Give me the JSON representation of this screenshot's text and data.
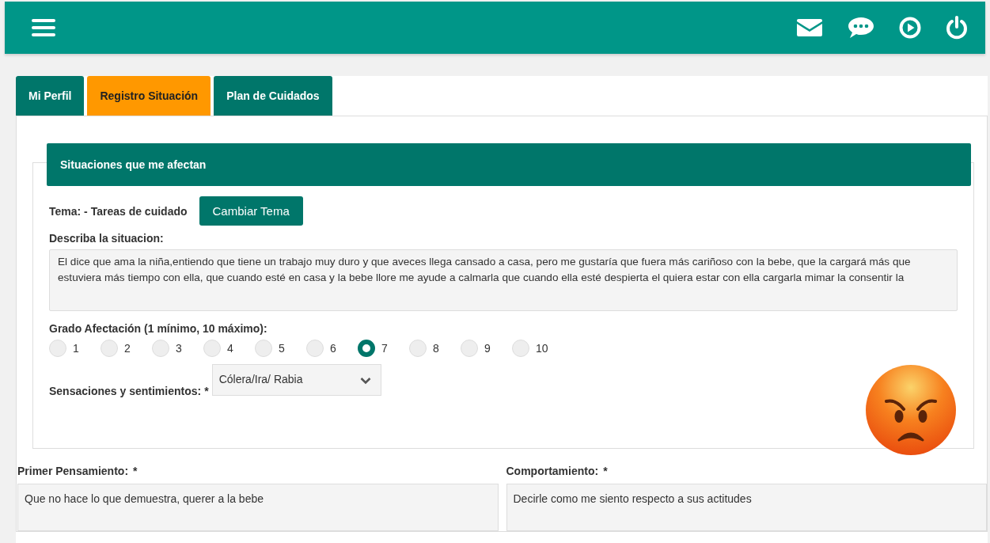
{
  "tabs": [
    {
      "label": "Mi Perfil",
      "selected": false
    },
    {
      "label": "Registro Situación",
      "selected": true
    },
    {
      "label": "Plan de Cuidados",
      "selected": false
    }
  ],
  "section": {
    "title": "Situaciones que me afectan"
  },
  "tema": {
    "label": "Tema: - Tareas de cuidado",
    "button": "Cambiar Tema"
  },
  "description": {
    "label": "Describa la situacion:",
    "value": "El dice que ama la niña,entiendo que tiene un trabajo muy duro y que aveces llega cansado a casa, pero me gustaría que fuera más cariñoso con la bebe, que la cargará más que estuviera más tiempo con ella, que cuando esté en casa y la bebe llore me ayude a calmarla que cuando ella esté despierta el quiera estar con ella cargarla mimar la consentir la"
  },
  "rating": {
    "label": "Grado Afectación (1 mínimo, 10 máximo):",
    "options": [
      {
        "label": "1",
        "selected": false
      },
      {
        "label": "2",
        "selected": false
      },
      {
        "label": "3",
        "selected": false
      },
      {
        "label": "4",
        "selected": false
      },
      {
        "label": "5",
        "selected": false
      },
      {
        "label": "6",
        "selected": false
      },
      {
        "label": "7",
        "selected": true
      },
      {
        "label": "8",
        "selected": false
      },
      {
        "label": "9",
        "selected": false
      },
      {
        "label": "10",
        "selected": false
      }
    ]
  },
  "feelings": {
    "label": "Sensaciones y sentimientos:",
    "required_mark": "*",
    "value": "Cólera/Ira/ Rabia"
  },
  "fields": [
    {
      "label": "Primer Pensamiento:",
      "required_mark": "*",
      "value": "Que no hace lo que demuestra, querer a la bebe"
    },
    {
      "label": "Comportamiento:",
      "required_mark": "*",
      "value": "Decirle como me siento respecto a sus actitudes"
    }
  ]
}
